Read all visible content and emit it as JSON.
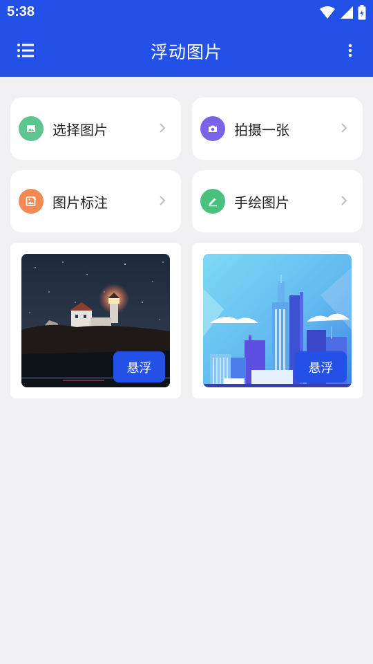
{
  "status_bar": {
    "time": "5:38",
    "icons": [
      "wifi-icon",
      "signal-icon",
      "battery-icon"
    ]
  },
  "app_bar": {
    "title": "浮动图片",
    "left_icon": "menu-list-icon",
    "right_icon": "more-vertical-icon"
  },
  "actions": [
    {
      "label": "选择图片",
      "icon": "image-icon",
      "color": "#5cc590"
    },
    {
      "label": "拍摄一张",
      "icon": "camera-icon",
      "color": "#7a63e8"
    },
    {
      "label": "图片标注",
      "icon": "annotate-image-icon",
      "color": "#f38a55"
    },
    {
      "label": "手绘图片",
      "icon": "pen-icon",
      "color": "#49c17d"
    }
  ],
  "images": [
    {
      "name": "lighthouse-night",
      "float_label": "悬浮"
    },
    {
      "name": "city-skyline",
      "float_label": "悬浮"
    }
  ],
  "colors": {
    "primary": "#2350e6",
    "background": "#f1f1f3",
    "card": "#ffffff"
  }
}
